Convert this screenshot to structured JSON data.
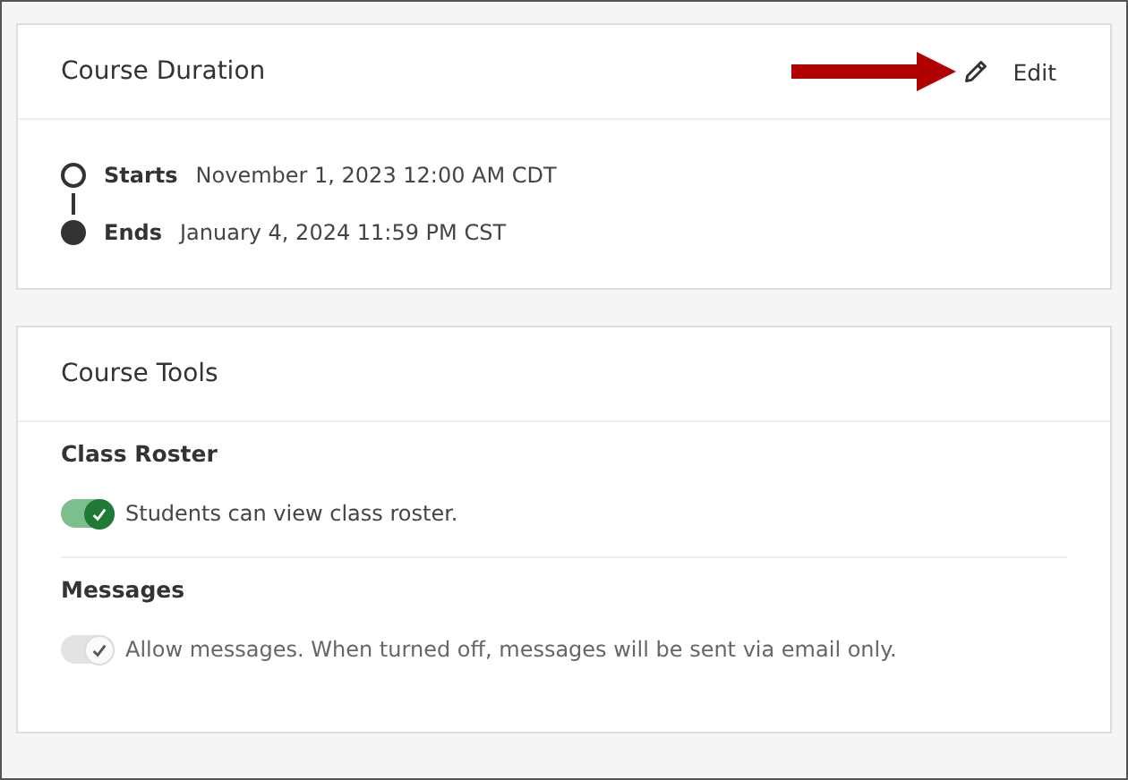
{
  "duration": {
    "title": "Course Duration",
    "edit_label": "Edit",
    "events": [
      {
        "label": "Starts",
        "value": "November 1, 2023 12:00 AM CDT",
        "filled": false
      },
      {
        "label": "Ends",
        "value": "January 4, 2024 11:59 PM CST",
        "filled": true
      }
    ]
  },
  "tools": {
    "title": "Course Tools",
    "sections": [
      {
        "heading": "Class Roster",
        "text": "Students can view class roster.",
        "on": true,
        "disabled": false
      },
      {
        "heading": "Messages",
        "text": "Allow messages. When turned off, messages will be sent via email only.",
        "on": true,
        "disabled": true
      }
    ]
  }
}
